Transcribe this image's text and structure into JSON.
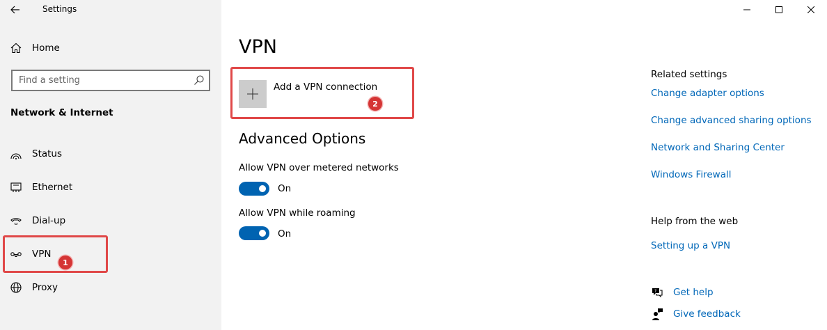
{
  "window": {
    "title": "Settings",
    "controls": [
      "minimize",
      "maximize",
      "close"
    ]
  },
  "sidebar": {
    "home_label": "Home",
    "search_placeholder": "Find a setting",
    "section_title": "Network & Internet",
    "items": [
      {
        "label": "Status",
        "icon": "status-icon"
      },
      {
        "label": "Ethernet",
        "icon": "ethernet-icon"
      },
      {
        "label": "Dial-up",
        "icon": "dialup-icon"
      },
      {
        "label": "VPN",
        "icon": "vpn-icon",
        "selected": true
      },
      {
        "label": "Proxy",
        "icon": "globe-icon"
      }
    ]
  },
  "main": {
    "title": "VPN",
    "add_vpn_label": "Add a VPN connection",
    "advanced_title": "Advanced Options",
    "options": [
      {
        "label": "Allow VPN over metered networks",
        "state": "On",
        "enabled": true
      },
      {
        "label": "Allow VPN while roaming",
        "state": "On",
        "enabled": true
      }
    ]
  },
  "related": {
    "title": "Related settings",
    "links": [
      "Change adapter options",
      "Change advanced sharing options",
      "Network and Sharing Center",
      "Windows Firewall"
    ],
    "help_title": "Help from the web",
    "help_links": [
      "Setting up a VPN"
    ],
    "get_help": "Get help",
    "give_feedback": "Give feedback"
  },
  "annotations": {
    "badge_1": "1",
    "badge_2": "2",
    "highlight_color": "#e04848"
  },
  "colors": {
    "accent": "#0063b1",
    "link": "#0067b8",
    "sidebar_bg": "#f2f2f2"
  }
}
